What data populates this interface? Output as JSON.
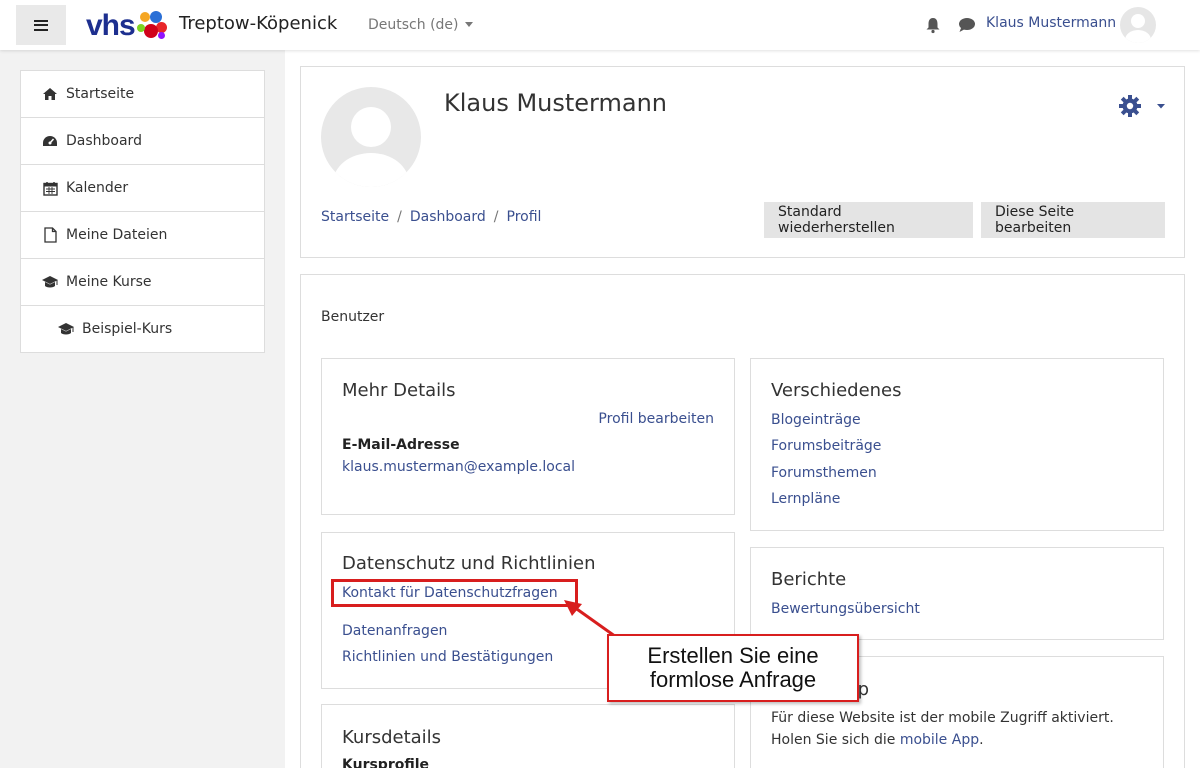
{
  "navbar": {
    "logo_text": "vhs",
    "site_name": "Treptow-Köpenick",
    "language": "Deutsch (de)",
    "username": "Klaus Mustermann",
    "icons": [
      "menu-icon",
      "bell-icon",
      "chat-icon",
      "avatar"
    ]
  },
  "sidebar": {
    "items": [
      {
        "label": "Startseite",
        "icon": "home-icon"
      },
      {
        "label": "Dashboard",
        "icon": "dashboard-icon"
      },
      {
        "label": "Kalender",
        "icon": "calendar-icon"
      },
      {
        "label": "Meine Dateien",
        "icon": "file-icon"
      },
      {
        "label": "Meine Kurse",
        "icon": "graduation-cap-icon"
      },
      {
        "label": "Beispiel-Kurs",
        "icon": "graduation-cap-icon"
      }
    ]
  },
  "header": {
    "name": "Klaus Mustermann",
    "breadcrumb": [
      "Startseite",
      "Dashboard",
      "Profil"
    ],
    "breadcrumb_sep": "/",
    "reset_button": "Standard wiederherstellen",
    "edit_button": "Diese Seite bearbeiten"
  },
  "content": {
    "section_label": "Benutzer",
    "details": {
      "title": "Mehr Details",
      "edit_link": "Profil bearbeiten",
      "email_label": "E-Mail-Adresse",
      "email": "klaus.musterman@example.local"
    },
    "privacy": {
      "title": "Datenschutz und Richtlinien",
      "links": [
        "Kontakt für Datenschutzfragen",
        "Datenanfragen",
        "Richtlinien und Bestätigungen"
      ]
    },
    "course": {
      "title": "Kursdetails",
      "subtitle": "Kursprofile"
    },
    "misc": {
      "title": "Verschiedenes",
      "links": [
        "Blogeinträge",
        "Forumsbeiträge",
        "Forumsthemen",
        "Lernpläne"
      ]
    },
    "reports": {
      "title": "Berichte",
      "links": [
        "Bewertungsübersicht"
      ]
    },
    "mobile": {
      "title_tail": "p",
      "text1": "Für diese Website ist der mobile Zugriff aktiviert.",
      "text2_prefix": "Holen Sie sich die ",
      "text2_link": "mobile App",
      "text2_suffix": "."
    }
  },
  "annotation": {
    "callout_line1": "Erstellen Sie eine",
    "callout_line2": "formlose Anfrage"
  },
  "colors": {
    "link": "#3a4f8f",
    "highlight": "#d81e1e",
    "button_bg": "#e4e4e4"
  }
}
